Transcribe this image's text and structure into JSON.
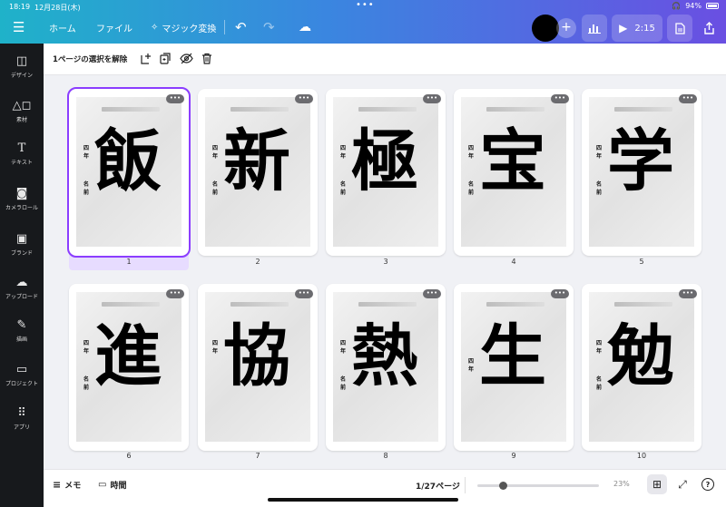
{
  "status": {
    "time": "18:19",
    "date": "12月28日(木)",
    "battery": "94%"
  },
  "topbar": {
    "home": "ホーム",
    "file": "ファイル",
    "magic": "マジック変換",
    "present_time": "2:15"
  },
  "sidebar": {
    "items": [
      {
        "label": "デザイン"
      },
      {
        "label": "素材"
      },
      {
        "label": "テキスト"
      },
      {
        "label": "カメラロール"
      },
      {
        "label": "ブランド"
      },
      {
        "label": "アップロード"
      },
      {
        "label": "描画"
      },
      {
        "label": "プロジェクト"
      },
      {
        "label": "アプリ"
      }
    ]
  },
  "actionbar": {
    "deselect": "1ページの選択を解除"
  },
  "pages": [
    {
      "num": "1",
      "kanji": "飯",
      "grade": "四年",
      "name": "名前"
    },
    {
      "num": "2",
      "kanji": "新",
      "grade": "四年",
      "name": "名前"
    },
    {
      "num": "3",
      "kanji": "極",
      "grade": "四年",
      "name": "名前"
    },
    {
      "num": "4",
      "kanji": "宝",
      "grade": "四年",
      "name": "名前"
    },
    {
      "num": "5",
      "kanji": "学",
      "grade": "四年",
      "name": "名前"
    },
    {
      "num": "6",
      "kanji": "進",
      "grade": "四年",
      "name": "名前"
    },
    {
      "num": "7",
      "kanji": "協",
      "grade": "四年",
      "name": ""
    },
    {
      "num": "8",
      "kanji": "熱",
      "grade": "四年",
      "name": "名前"
    },
    {
      "num": "9",
      "kanji": "生",
      "grade": "四年",
      "name": ""
    },
    {
      "num": "10",
      "kanji": "勉",
      "grade": "四年",
      "name": "名前"
    }
  ],
  "footer": {
    "memo": "メモ",
    "time": "時間",
    "pages_count": "1/27ページ",
    "zoom": "23%"
  }
}
